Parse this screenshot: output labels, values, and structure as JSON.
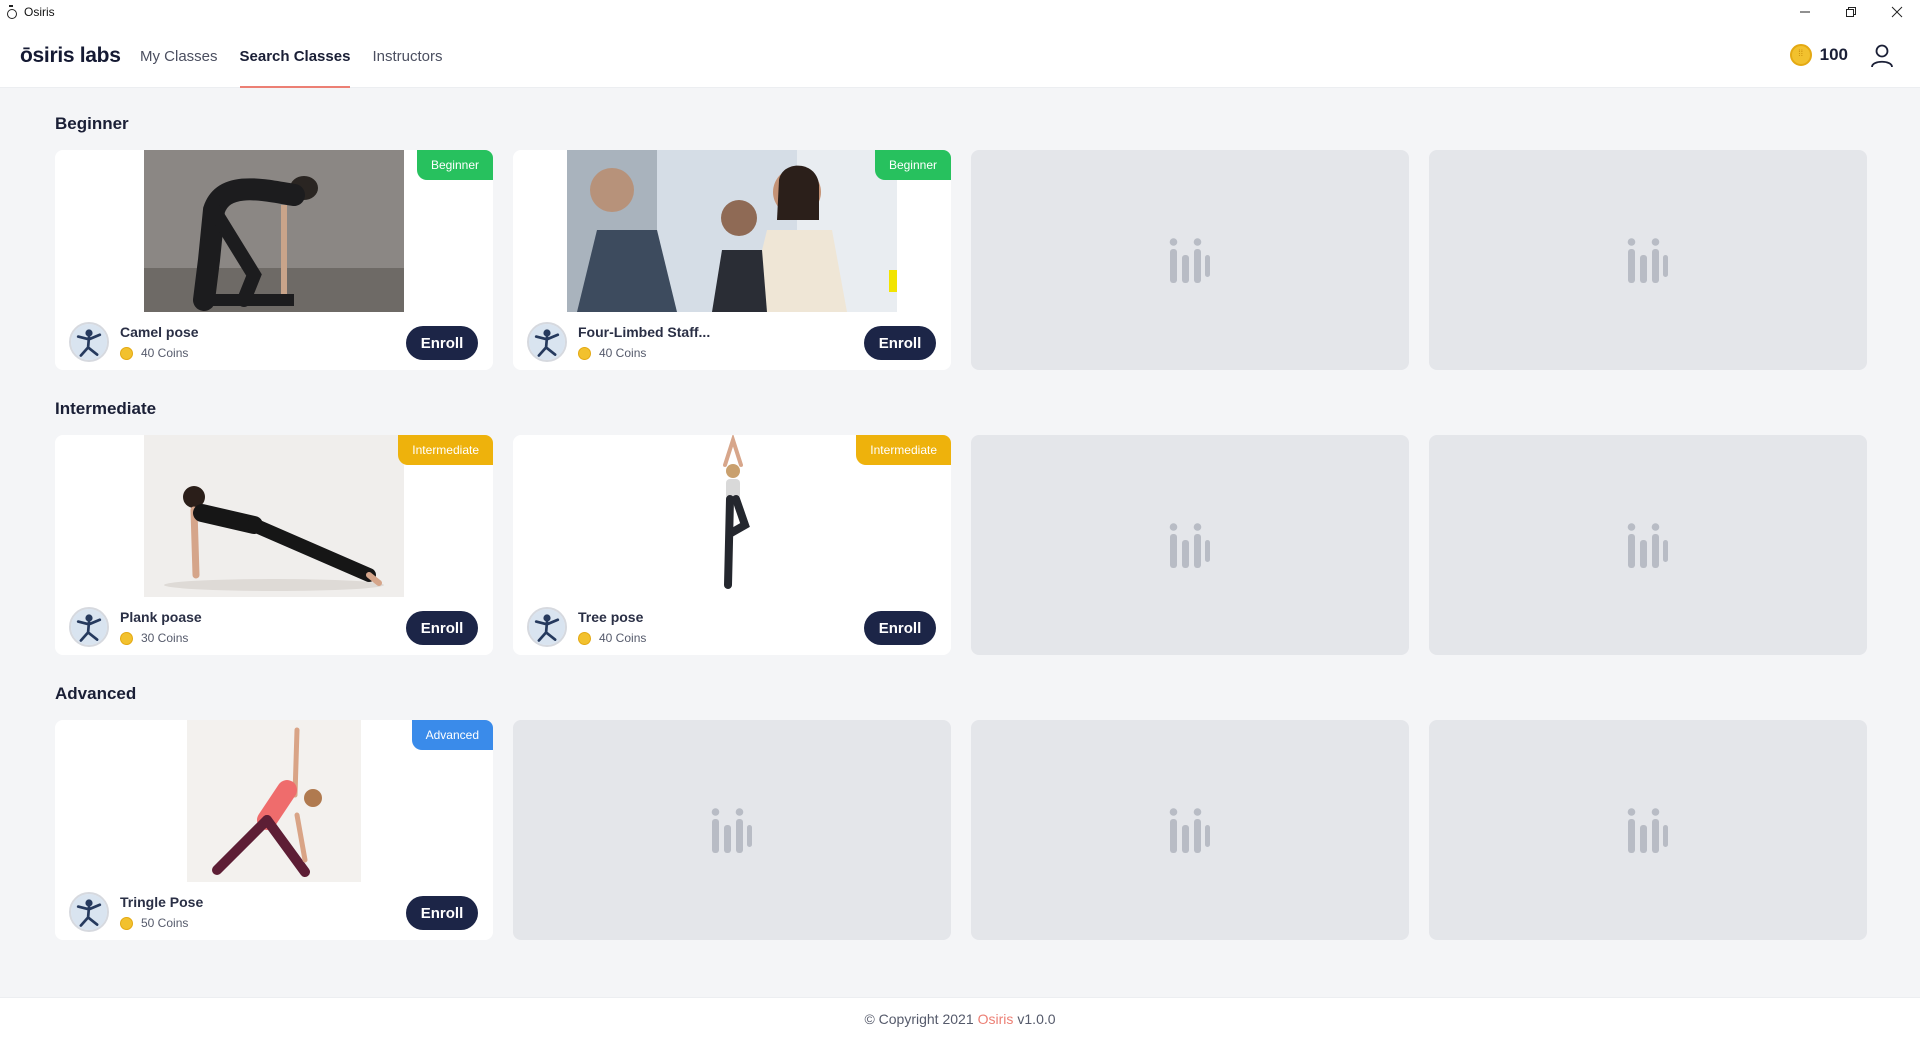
{
  "window": {
    "title": "Osiris"
  },
  "header": {
    "logo": "ōsiris labs",
    "nav": [
      {
        "label": "My Classes",
        "active": false
      },
      {
        "label": "Search Classes",
        "active": true
      },
      {
        "label": "Instructors",
        "active": false
      }
    ],
    "coins": "100"
  },
  "sections": [
    {
      "title": "Beginner",
      "cards": [
        {
          "name": "Camel pose",
          "coins": "40 Coins",
          "badge": "Beginner",
          "enroll": "Enroll"
        },
        {
          "name": "Four-Limbed Staff...",
          "coins": "40 Coins",
          "badge": "Beginner",
          "enroll": "Enroll"
        }
      ]
    },
    {
      "title": "Intermediate",
      "cards": [
        {
          "name": "Plank poase",
          "coins": "30 Coins",
          "badge": "Intermediate",
          "enroll": "Enroll"
        },
        {
          "name": "Tree pose",
          "coins": "40 Coins",
          "badge": "Intermediate",
          "enroll": "Enroll"
        }
      ]
    },
    {
      "title": "Advanced",
      "cards": [
        {
          "name": "Tringle Pose",
          "coins": "50 Coins",
          "badge": "Advanced",
          "enroll": "Enroll"
        }
      ]
    }
  ],
  "footer": {
    "copyright": "© Copyright 2021",
    "brand": "Osiris",
    "version": "v1.0.0"
  },
  "colors": {
    "beginner": "#27c15e",
    "intermediate": "#eeb20c",
    "advanced": "#3a8bea",
    "enroll_button": "#1c2547",
    "accent": "#ec7f74"
  }
}
